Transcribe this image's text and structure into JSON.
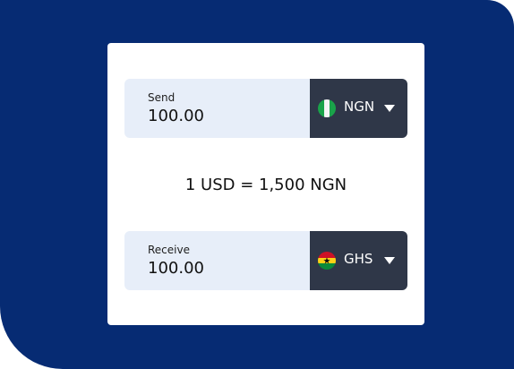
{
  "converter": {
    "send": {
      "label": "Send",
      "amount": "100.00",
      "currency": "NGN",
      "flag_icon": "nigeria-flag-icon"
    },
    "rate_text": "1 USD = 1,500 NGN",
    "receive": {
      "label": "Receive",
      "amount": "100.00",
      "currency": "GHS",
      "flag_icon": "ghana-flag-icon"
    }
  },
  "colors": {
    "background_navy": "#062B73",
    "card": "#FFFFFF",
    "amount_field": "#E7EEF9",
    "currency_selector": "#2F3748"
  }
}
